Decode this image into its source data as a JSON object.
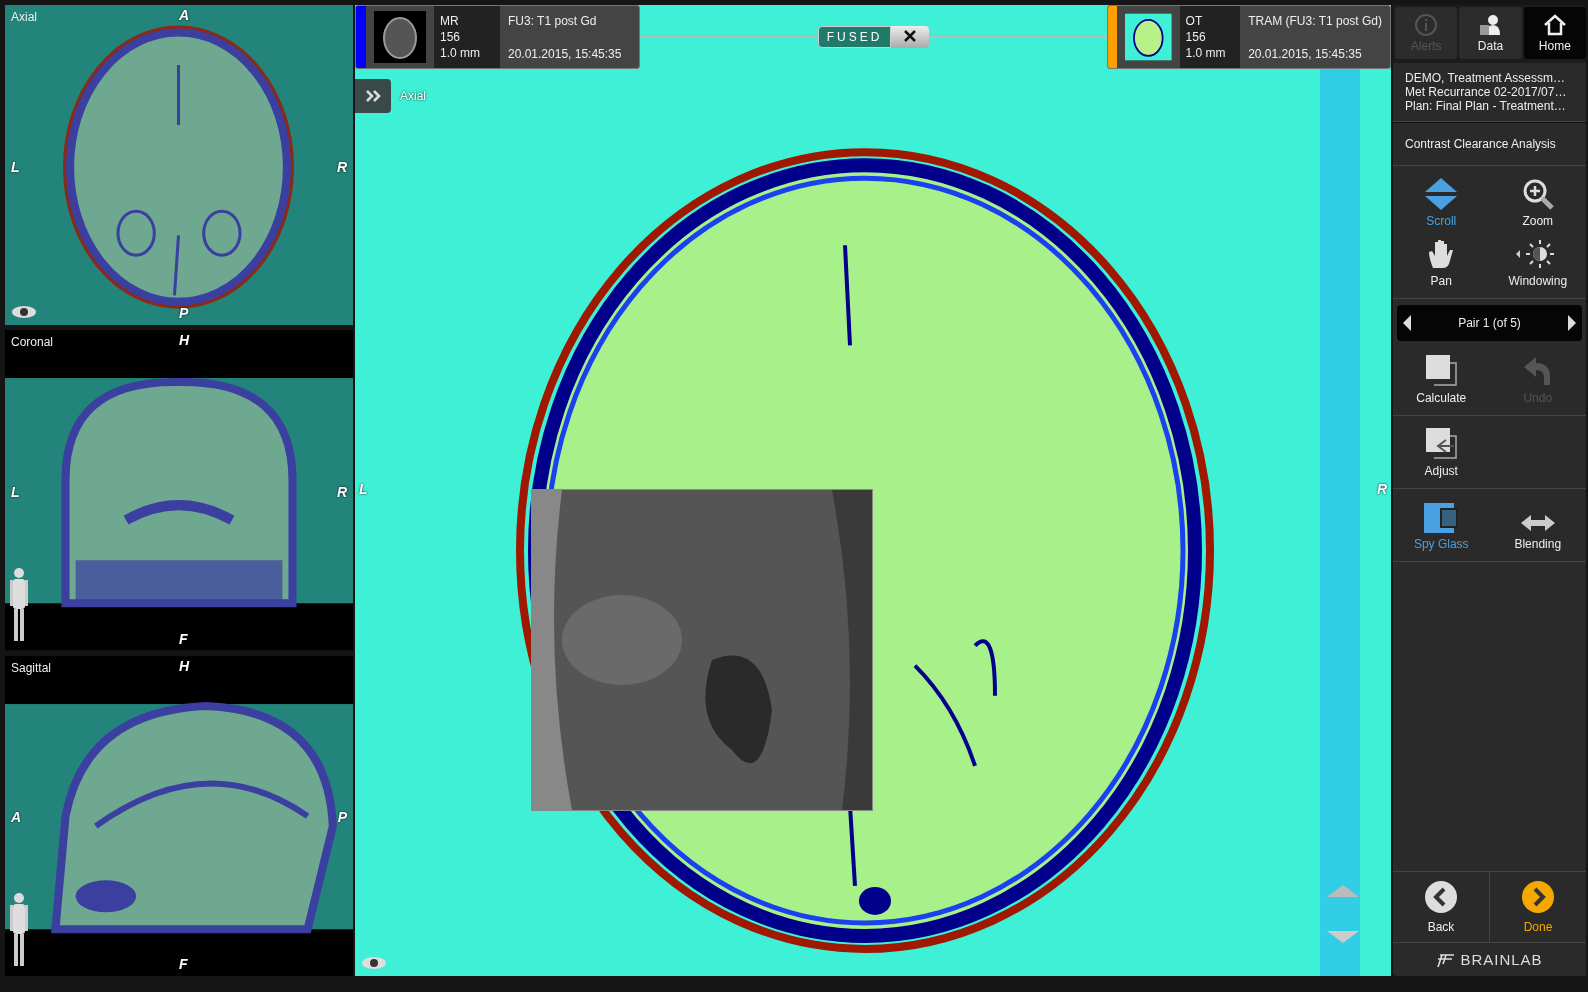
{
  "views": [
    {
      "kind": "axial",
      "title": "Axial",
      "top": "A",
      "bottom": "P",
      "left": "L",
      "right": "R"
    },
    {
      "kind": "coronal",
      "title": "Coronal",
      "top": "H",
      "bottom": "F",
      "left": "L",
      "right": "R"
    },
    {
      "kind": "sagittal",
      "title": "Sagittal",
      "top": "H",
      "bottom": "F",
      "left": "A",
      "right": "P"
    }
  ],
  "main_view": {
    "title": "Axial",
    "left": "L",
    "right": "R",
    "series": [
      {
        "modality": "MR",
        "slice": "156",
        "thickness": "1.0 mm",
        "name": "FU3: T1 post Gd",
        "date": "20.01.2015, 15:45:35",
        "color": "#0000ff"
      },
      {
        "modality": "OT",
        "slice": "156",
        "thickness": "1.0 mm",
        "name": "TRAM (FU3: T1 post Gd)",
        "date": "20.01.2015, 15:45:35",
        "color": "#ffa000"
      }
    ],
    "fused_label": "FUSED",
    "spy_glass": true
  },
  "sidebar": {
    "top_buttons": [
      {
        "kind": "alerts",
        "label": "Alerts",
        "selected": false,
        "disabled": true
      },
      {
        "kind": "data",
        "label": "Data",
        "selected": false,
        "disabled": false
      },
      {
        "kind": "home",
        "label": "Home",
        "selected": true,
        "disabled": false
      }
    ],
    "patient_lines": [
      "DEMO, Treatment Assessm…",
      "Met Recurrance 02-2017/07…",
      "Plan: Final Plan - Treatment…"
    ],
    "workflow": "Contrast Clearance Analysis",
    "tool_groups": [
      {
        "tools": [
          {
            "kind": "scroll",
            "label": "Scroll",
            "selected": true,
            "disabled": false
          },
          {
            "kind": "zoom",
            "label": "Zoom",
            "selected": false,
            "disabled": false
          },
          {
            "kind": "pan",
            "label": "Pan",
            "selected": false,
            "disabled": false
          },
          {
            "kind": "windowing",
            "label": "Windowing",
            "selected": false,
            "disabled": false
          }
        ]
      },
      {
        "pair": "Pair 1 (of 5)",
        "tools": [
          {
            "kind": "calculate",
            "label": "Calculate",
            "selected": false,
            "disabled": false
          },
          {
            "kind": "undo",
            "label": "Undo",
            "selected": false,
            "disabled": true
          }
        ]
      },
      {
        "tools": [
          {
            "kind": "adjust",
            "label": "Adjust",
            "selected": false,
            "disabled": false
          }
        ]
      },
      {
        "tools": [
          {
            "kind": "spyglass",
            "label": "Spy Glass",
            "selected": true,
            "disabled": false
          },
          {
            "kind": "blending",
            "label": "Blending",
            "selected": false,
            "disabled": false
          }
        ]
      }
    ],
    "footer_buttons": [
      {
        "kind": "back",
        "label": "Back"
      },
      {
        "kind": "done",
        "label": "Done"
      }
    ],
    "logo": "BRAINLAB"
  }
}
